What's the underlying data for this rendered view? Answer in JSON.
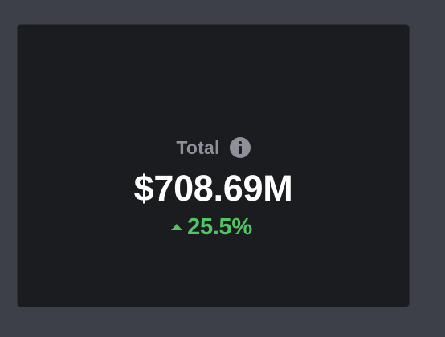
{
  "card": {
    "title": "Total",
    "info_icon": "info-icon",
    "value": "$708.69M",
    "change": {
      "direction_icon": "triangle-up-icon",
      "text": "25.5%",
      "color": "#52c465"
    }
  },
  "colors": {
    "page_background": "#3d4048",
    "card_background": "#1b1c20",
    "title_color": "#8e9099",
    "value_color": "#ffffff",
    "positive_color": "#52c465"
  }
}
